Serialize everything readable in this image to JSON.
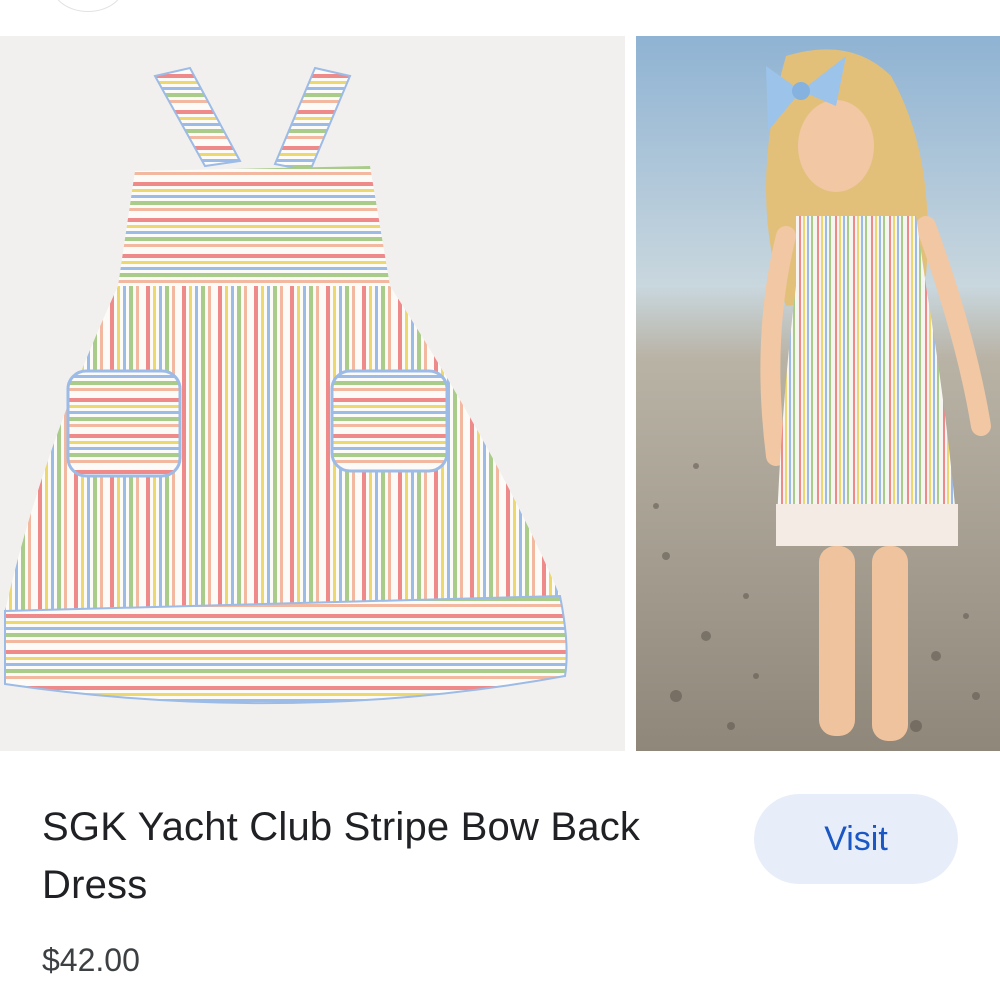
{
  "product": {
    "title": "SGK Yacht Club Stripe Bow Back Dress",
    "price": "$42.00"
  },
  "actions": {
    "visit_label": "Visit"
  },
  "images": {
    "product_icon": "dress-photo",
    "model_icon": "girl-on-beach-photo"
  },
  "colors": {
    "visit_bg": "#e8eef9",
    "visit_text": "#1a57c4",
    "stripe_pink": "#ee8a8a",
    "stripe_yellow": "#ecd86e",
    "stripe_blue": "#9cbbe6",
    "stripe_green": "#a9cc8a"
  }
}
